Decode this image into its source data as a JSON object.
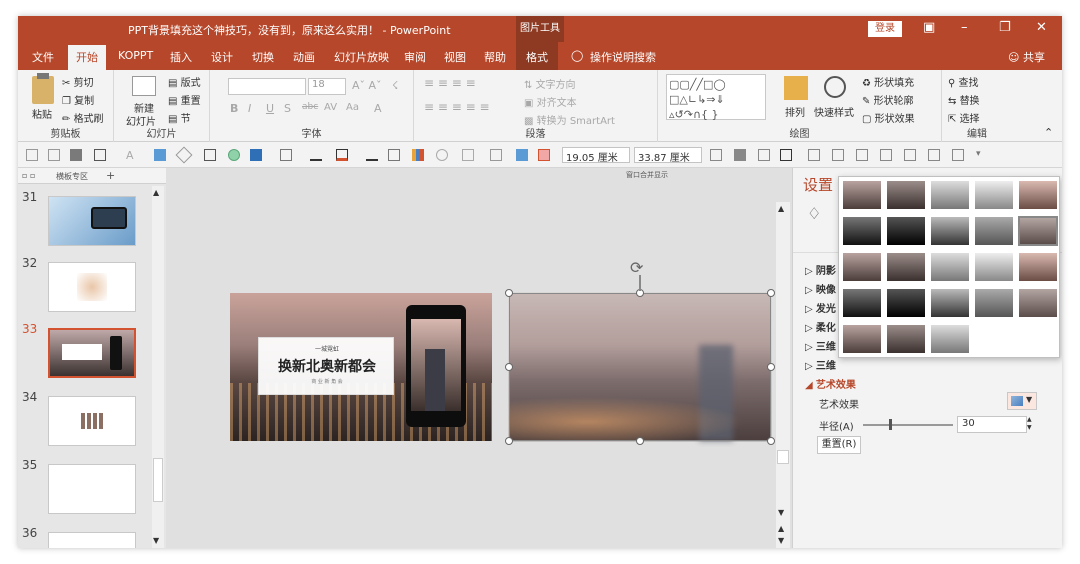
{
  "titlebar": {
    "title": "PPT背景填充这个神技巧，没有到，原来这么实用！ - PowerPoint",
    "context_tab": "图片工具",
    "login": "登录"
  },
  "tabs": [
    {
      "label": "文件"
    },
    {
      "label": "开始"
    },
    {
      "label": "KOPPT"
    },
    {
      "label": "插入"
    },
    {
      "label": "设计"
    },
    {
      "label": "切换"
    },
    {
      "label": "动画"
    },
    {
      "label": "幻灯片放映"
    },
    {
      "label": "审阅"
    },
    {
      "label": "视图"
    },
    {
      "label": "帮助"
    },
    {
      "label": "格式"
    }
  ],
  "tell_me": "操作说明搜索",
  "share": "共享",
  "ribbon": {
    "clipboard": {
      "paste": "粘贴",
      "cut": "剪切",
      "copy": "复制",
      "format_painter": "格式刷",
      "label": "剪贴板"
    },
    "slides": {
      "new_slide": "新建",
      "new_slide2": "幻灯片",
      "layout": "版式",
      "reset": "重置",
      "section": "节",
      "label": "幻灯片"
    },
    "font": {
      "size": "18",
      "label": "字体"
    },
    "paragraph": {
      "text_direction": "文字方向",
      "align_text": "对齐文本",
      "smartart": "转换为 SmartArt",
      "label": "段落"
    },
    "drawing": {
      "arrange": "排列",
      "quick_styles": "快速样式",
      "fill": "形状填充",
      "outline": "形状轮廓",
      "effects": "形状效果",
      "label": "绘图"
    },
    "editing": {
      "find": "查找",
      "replace": "替换",
      "select": "选择",
      "label": "编辑"
    }
  },
  "qbar": {
    "height": "19.05 厘米",
    "width": "33.87 厘米"
  },
  "leftpanel": {
    "tab_label": "横板专区",
    "merge_label": "窗口合并显示",
    "slides": [
      {
        "num": "31"
      },
      {
        "num": "32"
      },
      {
        "num": "33"
      },
      {
        "num": "34"
      },
      {
        "num": "35"
      },
      {
        "num": "36"
      }
    ]
  },
  "slide": {
    "small_title": "一城霓虹",
    "big_title": "换新北奥新都会",
    "sub": "商 业 新 角 会"
  },
  "rpanel": {
    "title": "设置",
    "items": [
      {
        "label": "阴影"
      },
      {
        "label": "映像"
      },
      {
        "label": "发光"
      },
      {
        "label": "柔化"
      },
      {
        "label": "三维"
      },
      {
        "label": "三维"
      }
    ],
    "art_section": "艺术效果",
    "art_label": "艺术效果",
    "radius_label": "半径(A)",
    "radius_value": "30",
    "reset": "重置(R)"
  },
  "gallery": {
    "selected_index": 9,
    "effect_count": 23
  },
  "colors": {
    "accent": "#b7472a",
    "accent_dark": "#8e3a22",
    "selection": "#d35230"
  }
}
